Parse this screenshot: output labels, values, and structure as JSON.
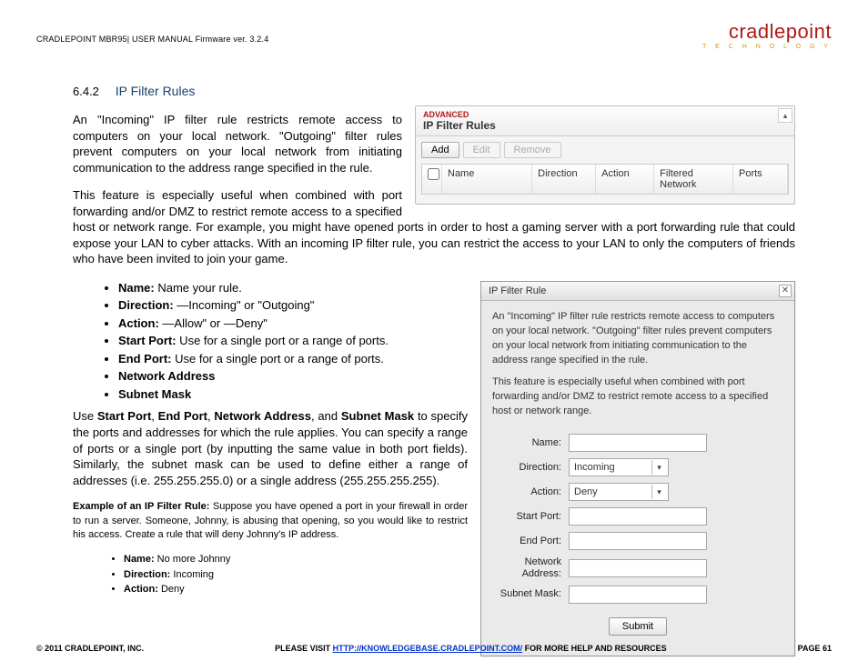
{
  "header": {
    "breadcrumb": "CRADLEPOINT MBR95| USER MANUAL Firmware ver. 3.2.4",
    "logo_main": "cradlepoint",
    "logo_sub": "T E C H N O L O G Y"
  },
  "section": {
    "number": "6.4.2",
    "title": "IP Filter Rules",
    "para1": "An \"Incoming\" IP filter rule restricts remote access to computers on your local network. \"Outgoing\" filter rules prevent computers on your local network from initiating communication to the address range specified in the rule.",
    "para2a": "This feature is especially useful when combined with port forwarding and/or DMZ to restrict remote access to a",
    "para2b": "specified host or network range. For example, you might have opened ports in order to host a gaming server with a port forwarding rule that could expose your LAN to cyber attacks. With an incoming IP filter rule, you can restrict the access to your LAN to only the computers of friends who have been invited to join your game.",
    "para3_prefix": "Use ",
    "para3_b1": "Start Port",
    "para3_s1": ", ",
    "para3_b2": "End Port",
    "para3_s2": ", ",
    "para3_b3": "Network Address",
    "para3_s3": ", and ",
    "para3_b4": "Subnet Mask",
    "para3_rest": " to specify the ports and addresses for which the rule applies. You can specify a range of ports or a single port (by inputting the same value in both port fields). Similarly, the subnet mask can be used to define either a range of addresses (i.e. 255.255.255.0) or a single address (255.255.255.255).",
    "example_label": "Example of an IP Filter Rule:",
    "example_text": " Suppose you have opened a port in your firewall in order to run a server. Someone, Johnny, is abusing that opening, so you would like to restrict his access. Create a rule that will deny Johnny's IP address."
  },
  "bullets_main": [
    {
      "b": "Name:",
      "t": " Name your rule."
    },
    {
      "b": "Direction:",
      "t": " ―Incoming\" or \"Outgoing\""
    },
    {
      "b": "Action:",
      "t": " ―Allow\" or ―Deny\""
    },
    {
      "b": "Start Port:",
      "t": " Use for a single port or a range of ports."
    },
    {
      "b": "End Port:",
      "t": " Use for a single port or a range of ports."
    },
    {
      "b": "Network Address",
      "t": ""
    },
    {
      "b": "Subnet Mask",
      "t": ""
    }
  ],
  "bullets_small": [
    {
      "b": "Name:",
      "t": " No more Johnny"
    },
    {
      "b": "Direction:",
      "t": " Incoming"
    },
    {
      "b": "Action:",
      "t": " Deny"
    }
  ],
  "panel_top": {
    "advanced": "ADVANCED",
    "title": "IP Filter Rules",
    "btn_add": "Add",
    "btn_edit": "Edit",
    "btn_remove": "Remove",
    "cols": {
      "name": "Name",
      "dir": "Direction",
      "act": "Action",
      "fn": "Filtered Network",
      "ports": "Ports"
    },
    "collapse_glyph": "▴"
  },
  "dialog": {
    "title": "IP Filter Rule",
    "close": "✕",
    "intro1": "An \"Incoming\" IP filter rule restricts remote access to computers on your local network. \"Outgoing\" filter rules prevent computers on your local network from initiating communication to the address range specified in the rule.",
    "intro2": "This feature is especially useful when combined with port forwarding and/or DMZ to restrict remote access to a specified host or network range.",
    "labels": {
      "name": "Name:",
      "direction": "Direction:",
      "action": "Action:",
      "start": "Start Port:",
      "end": "End Port:",
      "net": "Network Address:",
      "mask": "Subnet Mask:"
    },
    "values": {
      "direction": "Incoming",
      "action": "Deny"
    },
    "submit": "Submit",
    "drop_glyph": "▾"
  },
  "footer": {
    "copyright": "© 2011 CRADLEPOINT, INC.",
    "center_pre": "PLEASE VISIT ",
    "center_link": "HTTP://KNOWLEDGEBASE.CRADLEPOINT.COM/",
    "center_post": " FOR MORE HELP AND RESOURCES",
    "page": "PAGE 61"
  }
}
